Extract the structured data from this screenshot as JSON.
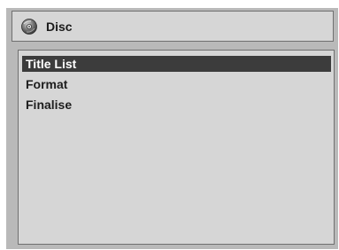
{
  "header": {
    "icon": "disc-icon",
    "title": "Disc"
  },
  "menu": {
    "items": [
      {
        "label": "Title List",
        "selected": true
      },
      {
        "label": "Format",
        "selected": false
      },
      {
        "label": "Finalise",
        "selected": false
      }
    ]
  },
  "colors": {
    "frame": "#b9b9b9",
    "panel": "#d6d6d6",
    "highlight": "#3c3c3c",
    "highlight_text": "#ffffff",
    "text": "#1e1e1e"
  }
}
